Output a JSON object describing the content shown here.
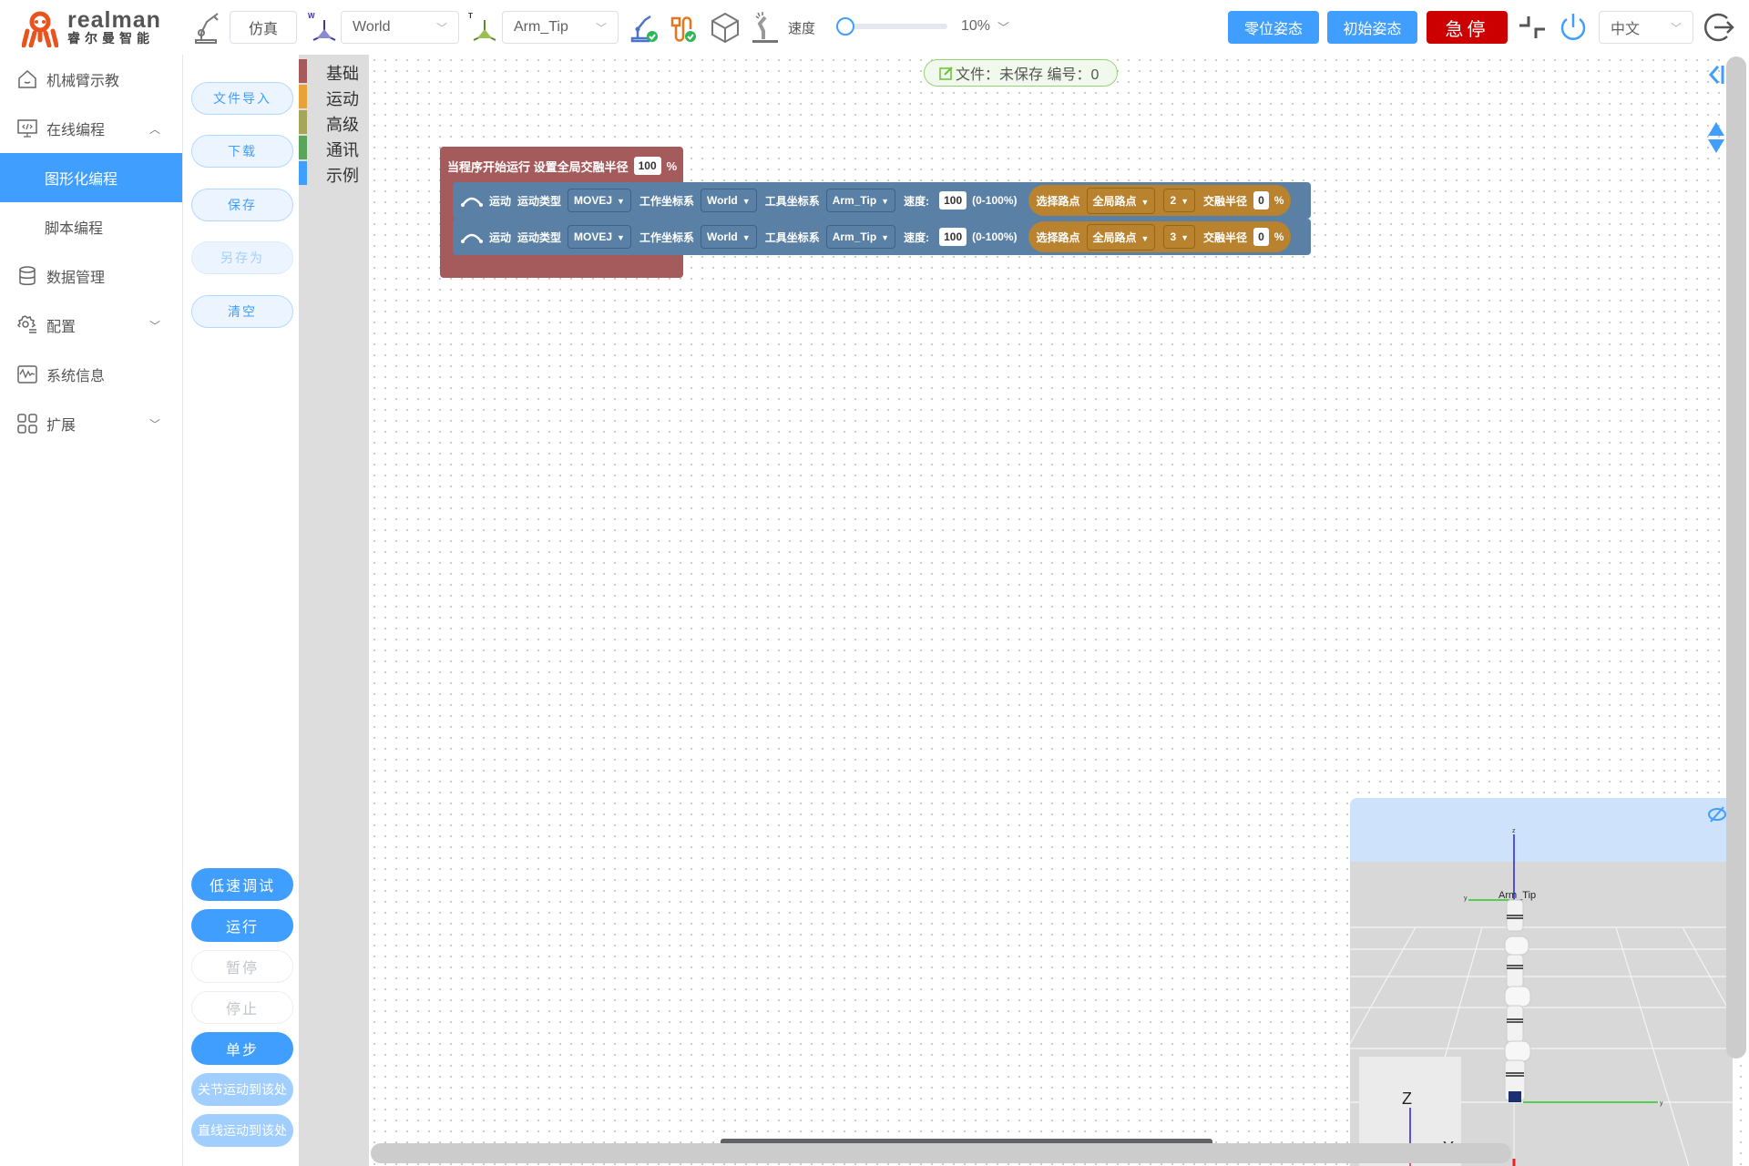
{
  "brand": {
    "name_en": "realman",
    "name_cn": "睿尔曼智能",
    "color": "#e8531e"
  },
  "header": {
    "mode_label": "仿真",
    "work_frame": {
      "label": "W",
      "value": "World"
    },
    "tool_frame": {
      "label": "T",
      "value": "Arm_Tip"
    },
    "speed_label": "速度",
    "speed_value": "10%",
    "speed_fraction": 0.1,
    "zero_pose_label": "零位姿态",
    "init_pose_label": "初始姿态",
    "estop_label": "急停",
    "language": "中文",
    "colors": {
      "primary": "#409eff",
      "estop": "#cc0000"
    }
  },
  "sidebar": {
    "items": [
      {
        "label": "机械臂示教",
        "icon": "home-icon"
      },
      {
        "label": "在线编程",
        "icon": "code-monitor-icon",
        "expanded": true
      },
      {
        "label": "图形化编程",
        "sub": true,
        "active": true
      },
      {
        "label": "脚本编程",
        "sub": true
      },
      {
        "label": "数据管理",
        "icon": "database-icon"
      },
      {
        "label": "配置",
        "icon": "settings-icon",
        "expandable": true
      },
      {
        "label": "系统信息",
        "icon": "pulse-icon"
      },
      {
        "label": "扩展",
        "icon": "grid-icon",
        "expandable": true
      }
    ]
  },
  "file_actions": {
    "import": "文件导入",
    "download": "下载",
    "save": "保存",
    "save_as": "另存为",
    "clear": "清空"
  },
  "run_actions": {
    "low_speed_debug": "低速调试",
    "run": "运行",
    "pause": "暂停",
    "stop": "停止",
    "step": "单步",
    "joint_move_here": "关节运动到该处",
    "linear_move_here": "直线运动到该处"
  },
  "toolbox": {
    "categories": [
      {
        "label": "基础",
        "color": "#a55b5b"
      },
      {
        "label": "运动",
        "color": "#e8a23a"
      },
      {
        "label": "高级",
        "color": "#a5a55b"
      },
      {
        "label": "通讯",
        "color": "#5ba55b"
      },
      {
        "label": "示例",
        "color": "#409eff"
      }
    ]
  },
  "file_status": {
    "text": "文件：未保存  编号：0"
  },
  "program": {
    "start_block": {
      "label": "当程序开始运行 设置全局交融半径",
      "value": "100",
      "unit": "%"
    },
    "motions": [
      {
        "label": "运动",
        "type_label": "运动类型",
        "type": "MOVEJ",
        "work_label": "工作坐标系",
        "work": "World",
        "tool_label": "工具坐标系",
        "tool": "Arm_Tip",
        "speed_label": "速度:",
        "speed": "100",
        "speed_range": "(0-100%)",
        "waypoint_label": "选择路点",
        "waypoint_scope": "全局路点",
        "waypoint": "2",
        "blend_label": "交融半径",
        "blend": "0",
        "blend_unit": "%"
      },
      {
        "label": "运动",
        "type_label": "运动类型",
        "type": "MOVEJ",
        "work_label": "工作坐标系",
        "work": "World",
        "tool_label": "工具坐标系",
        "tool": "Arm_Tip",
        "speed_label": "速度:",
        "speed": "100",
        "speed_range": "(0-100%)",
        "waypoint_label": "选择路点",
        "waypoint_scope": "全局路点",
        "waypoint": "3",
        "blend_label": "交融半径",
        "blend": "0",
        "blend_unit": "%"
      }
    ]
  },
  "viewer": {
    "tool_label": "Arm_Tip",
    "axis_labels": {
      "z": "Z",
      "y": "Y",
      "x": "X"
    }
  }
}
